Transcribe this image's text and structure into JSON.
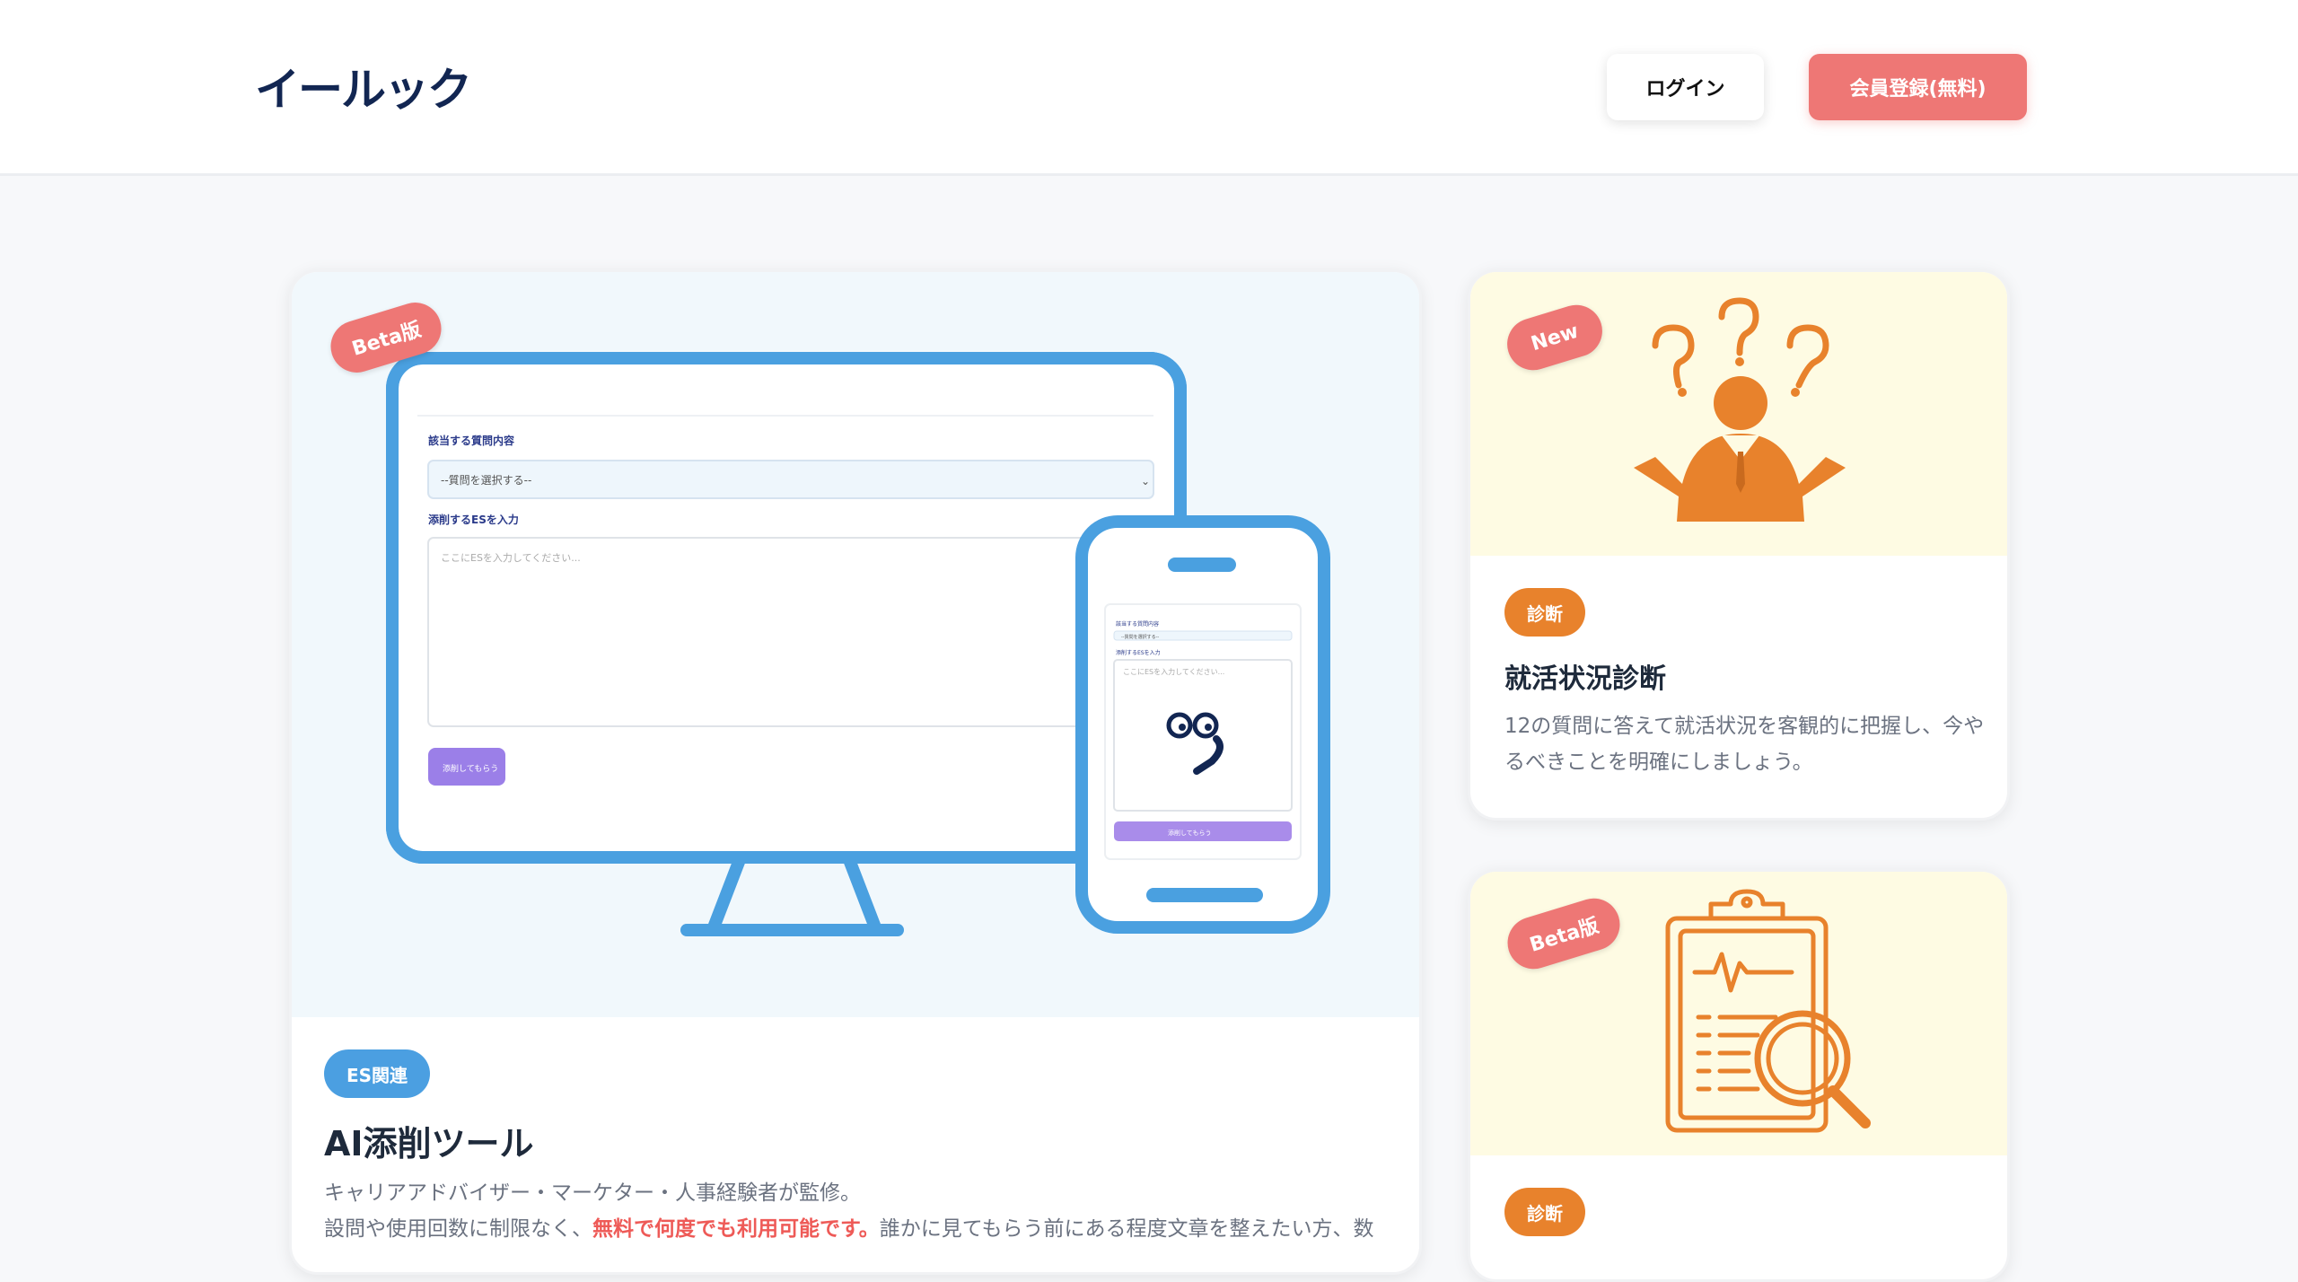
{
  "header": {
    "logo_text": "イールック",
    "logo_eyes": "©©",
    "login_label": "ログイン",
    "register_label": "会員登録(無料)"
  },
  "main_card": {
    "ribbon": "Beta版",
    "tag": "ES関連",
    "title": "AI添削ツール",
    "desc_line1": "キャリアアドバイザー・マーケター・人事経験者が監修。",
    "desc_line2_a": "設問や使用回数に制限なく、",
    "desc_line2_hl": "無料で何度でも利用可能です。",
    "desc_line2_b": "誰かに見てもらう前にある程度文章を整えたい方、数",
    "mockup": {
      "q_label": "該当する質問内容",
      "select_placeholder": "--質問を選択する--",
      "es_label": "添削するESを入力",
      "textarea_placeholder": "ここにESを入力してください...",
      "submit_label": "添削してもらう",
      "mobile_textarea_placeholder": "ここにESを入力してください...",
      "mobile_q_label": "該当する質問内容",
      "mobile_es_label": "添削するESを入力",
      "mobile_select": "--質問を選択する--",
      "mobile_submit": "添削してもらう"
    }
  },
  "card_status": {
    "ribbon": "New",
    "tag": "診断",
    "title": "就活状況診断",
    "desc": "12の質問に答えて就活状況を客観的に把握し、今やるべきことを明確にしましょう。"
  },
  "card_second": {
    "ribbon": "Beta版",
    "tag": "診断"
  },
  "colors": {
    "brand_navy": "#122652",
    "accent_coral": "#ee7775",
    "tag_blue": "#4b9fe1",
    "tag_orange": "#e8822c",
    "illustration_blue": "#4aa0e0",
    "illustration_orange": "#e8822c"
  },
  "icons": [
    "question-person-icon",
    "clipboard-search-icon",
    "monitor-phone-illustration"
  ]
}
